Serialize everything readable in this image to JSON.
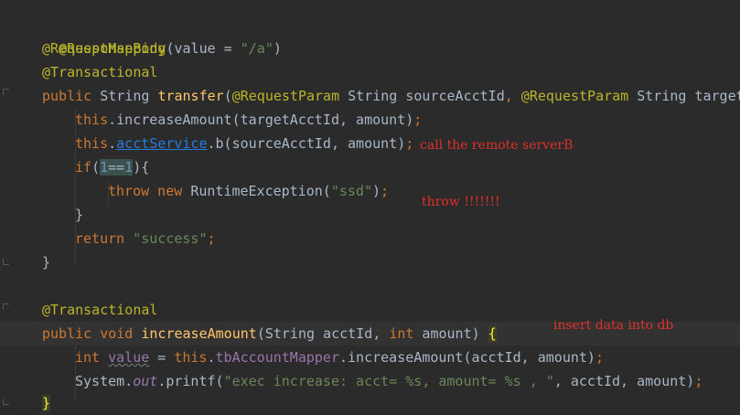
{
  "code": {
    "l1": {
      "ann": "@ResponseBody"
    },
    "l2": {
      "ann": "@RequestMapping",
      "open": "(",
      "key": "value = ",
      "str": "\"/a\"",
      "close": ")"
    },
    "l3": {
      "ann": "@Transactional"
    },
    "l4": {
      "kw": "public",
      "type": " String ",
      "fn": "transfer",
      "p1": "(",
      "ann1": "@RequestParam",
      "t1": " String sourceAcctId",
      "comma": ", ",
      "ann2": "@RequestParam",
      "t2": " String target"
    },
    "l5": {
      "kw": "this",
      "rest": ".increaseAmount(targetAcctId, amount)",
      "semi": ";"
    },
    "l6": {
      "kw": "this",
      "dot": ".",
      "link": "acctService",
      "rest": ".b(sourceAcctId, amount)",
      "semi": ";"
    },
    "l7": {
      "kw": "if",
      "p": "(",
      "num1": "1",
      "op": "==",
      "num2": "1",
      "end": "){"
    },
    "l8": {
      "kw1": "throw",
      "kw2": " new ",
      "cls": "RuntimeException(",
      "str": "\"ssd\"",
      "end": ")",
      "semi": ";"
    },
    "l9": {
      "text": "}"
    },
    "l10": {
      "kw": "return ",
      "str": "\"success\"",
      "semi": ";"
    },
    "l11": {
      "text": "}"
    },
    "l12": {
      "ann": "@Transactional"
    },
    "l13": {
      "kw1": "public",
      "kw2": " void ",
      "fn": "increaseAmount",
      "open": "(String acctId, ",
      "kw3": "int",
      "rest": " amount) ",
      "brace": "{"
    },
    "l14": {
      "kw": "int ",
      "var": "value",
      "eq": " = ",
      "kw2": "this",
      "dot": ".",
      "fld": "tbAccountMapper",
      "rest": ".increaseAmount(acctId, amount)",
      "semi": ";"
    },
    "l15": {
      "cls": "System.",
      "sfld": "out",
      "call": ".printf(",
      "str": "\"exec increase: acct= %s, amount= %s , \"",
      "rest": ", acctId, amount)",
      "semi": ";"
    },
    "l16": {
      "text": "}"
    }
  },
  "annotations": {
    "remote": "call the remote serverB",
    "throw": "throw !!!!!!!",
    "insert": "insert data into db"
  },
  "colors": {
    "background": "#2b2b2b",
    "annotation": "#bbb529",
    "keyword": "#cc7832",
    "method": "#ffc66d",
    "string": "#6a8759",
    "comment_red": "#e0302a"
  }
}
